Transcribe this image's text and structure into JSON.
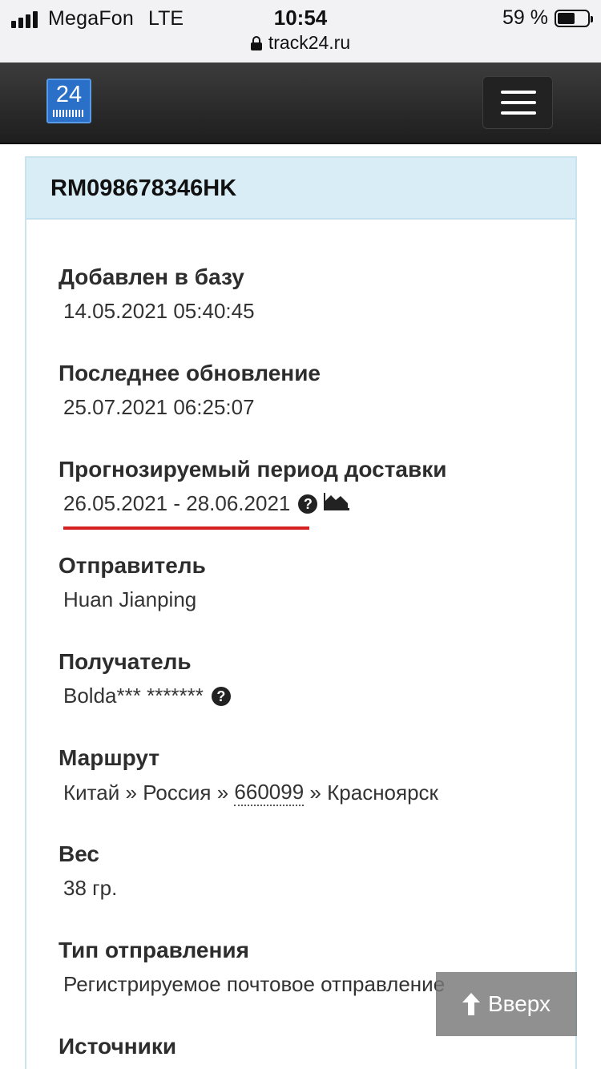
{
  "status_bar": {
    "carrier": "MegaFon",
    "network": "LTE",
    "time": "10:54",
    "battery_percent": "59 %",
    "battery_level": 0.59
  },
  "browser": {
    "url": "track24.ru"
  },
  "header": {
    "logo_text": "24",
    "logo_color": "#2a70c9",
    "menu_icon": "hamburger-menu-icon"
  },
  "card": {
    "tracking_number": "RM098678346HK",
    "header_bg": "#d9edf7"
  },
  "fields": {
    "added": {
      "label": "Добавлен в базу",
      "value": "14.05.2021 05:40:45"
    },
    "updated": {
      "label": "Последнее обновление",
      "value": "25.07.2021 06:25:07"
    },
    "forecast": {
      "label": "Прогнозируемый период доставки",
      "value": "26.05.2021 - 28.06.2021",
      "underline_color": "#d42020"
    },
    "sender": {
      "label": "Отправитель",
      "value": "Huan Jianping"
    },
    "recipient": {
      "label": "Получатель",
      "value": "Bolda*** *******"
    },
    "route": {
      "label": "Маршрут",
      "from": "Китай",
      "sep1": "»",
      "via": "Россия",
      "sep2": "»",
      "postcode": "660099",
      "sep3": "»",
      "city": "Красноярск"
    },
    "weight": {
      "label": "Вес",
      "value": "38 гр."
    },
    "type": {
      "label": "Тип отправления",
      "value": "Регистрируемое почтовое отправление"
    },
    "sources": {
      "label": "Источники"
    }
  },
  "back_to_top": {
    "label": "Вверх"
  }
}
